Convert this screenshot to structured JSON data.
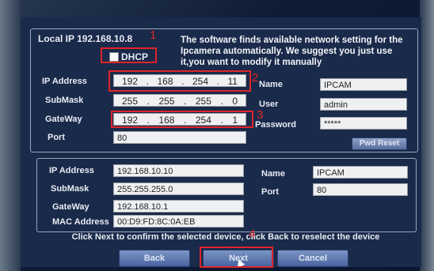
{
  "local_ip": {
    "label": "Local IP 192.168.10.8"
  },
  "dhcp": {
    "label": "DHCP"
  },
  "notice": "The software finds available network setting for the Ipcamera automatically. We suggest you just use it,you want to modify it manually",
  "top": {
    "ip_label": "IP Address",
    "ip": [
      "192",
      "168",
      "254",
      "11"
    ],
    "submask_label": "SubMask",
    "submask": [
      "255",
      "255",
      "255",
      "0"
    ],
    "gateway_label": "GateWay",
    "gateway": [
      "192",
      "168",
      "254",
      "1"
    ],
    "port_label": "Port",
    "port": "80",
    "name_label": "Name",
    "name": "IPCAM",
    "user_label": "User",
    "user": "admin",
    "password_label": "Password",
    "password": "*****",
    "pwd_reset": "Pwd Reset"
  },
  "device": {
    "ip_label": "IP Address",
    "ip": "192.168.10.10",
    "submask_label": "SubMask",
    "submask": "255.255.255.0",
    "gateway_label": "GateWay",
    "gateway": "192.168.10.1",
    "mac_label": "MAC Address",
    "mac": "00:D9:FD:8C:0A:EB",
    "name_label": "Name",
    "name": "IPCAM",
    "port_label": "Port",
    "port": "80"
  },
  "footer": "Click Next to confirm the selected device, click Back to reselect the device",
  "buttons": {
    "back": "Back",
    "next": "Next",
    "cancel": "Cancel"
  },
  "annotations": {
    "n1": "1",
    "n2": "2",
    "n3": "3",
    "n4": "4"
  },
  "colors": {
    "annotation": "#e0242a",
    "panel": "#1a2a4a",
    "button": "#4863a0"
  }
}
